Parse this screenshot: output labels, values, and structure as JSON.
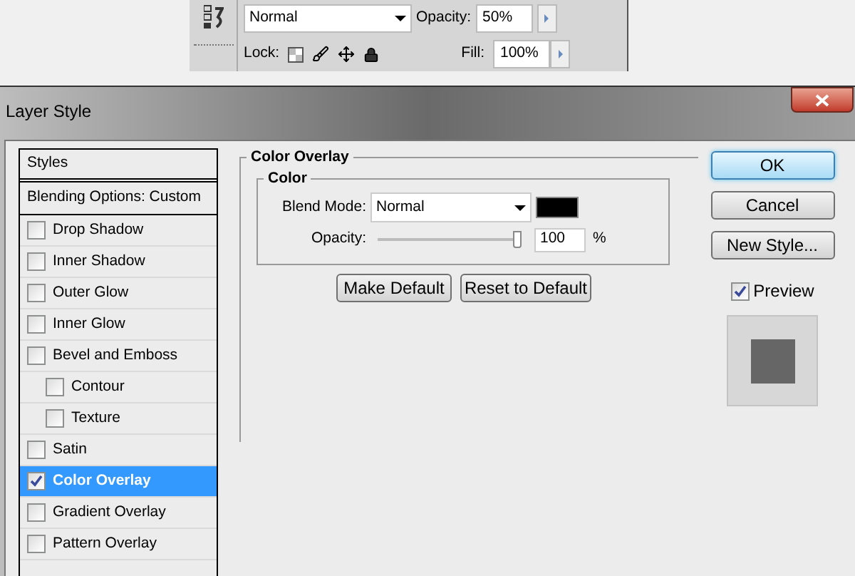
{
  "layers_panel": {
    "blend_mode": "Normal",
    "opacity_label": "Opacity:",
    "opacity": "50%",
    "lock_label": "Lock:",
    "fill_label": "Fill:",
    "fill": "100%"
  },
  "window": {
    "title": "Layer Style"
  },
  "styles": [
    {
      "kind": "header",
      "label": "Styles",
      "selected": false
    },
    {
      "kind": "options",
      "label": "Blending Options: Custom",
      "selected": false
    },
    {
      "kind": "effect",
      "label": "Drop Shadow",
      "checked": false,
      "selected": false
    },
    {
      "kind": "effect",
      "label": "Inner Shadow",
      "checked": false,
      "selected": false
    },
    {
      "kind": "effect",
      "label": "Outer Glow",
      "checked": false,
      "selected": false
    },
    {
      "kind": "effect",
      "label": "Inner Glow",
      "checked": false,
      "selected": false
    },
    {
      "kind": "effect",
      "label": "Bevel and Emboss",
      "checked": false,
      "selected": false,
      "children": [
        {
          "kind": "effect",
          "label": "Contour",
          "checked": false,
          "selected": false
        },
        {
          "kind": "effect",
          "label": "Texture",
          "checked": false,
          "selected": false
        }
      ]
    },
    {
      "kind": "effect",
      "label": "Satin",
      "checked": false,
      "selected": false
    },
    {
      "kind": "effect",
      "label": "Color Overlay",
      "checked": true,
      "selected": true
    },
    {
      "kind": "effect",
      "label": "Gradient Overlay",
      "checked": false,
      "selected": false
    },
    {
      "kind": "effect",
      "label": "Pattern Overlay",
      "checked": false,
      "selected": false
    }
  ],
  "section": {
    "title": "Color Overlay",
    "group": "Color",
    "blend_mode_label": "Blend Mode:",
    "blend_mode": "Normal",
    "color": "#000000",
    "opacity_label": "Opacity:",
    "opacity": {
      "level": 1
    },
    "opacity_value": "100",
    "opacity_unit": "%"
  },
  "section_buttons": [
    "Make Default",
    "Reset to Default"
  ],
  "buttons": [
    {
      "label": "OK",
      "default": true
    },
    {
      "label": "Cancel",
      "default": false
    },
    {
      "label": "New Style...",
      "default": false
    }
  ],
  "preview": {
    "label": "Preview",
    "checked": true
  }
}
